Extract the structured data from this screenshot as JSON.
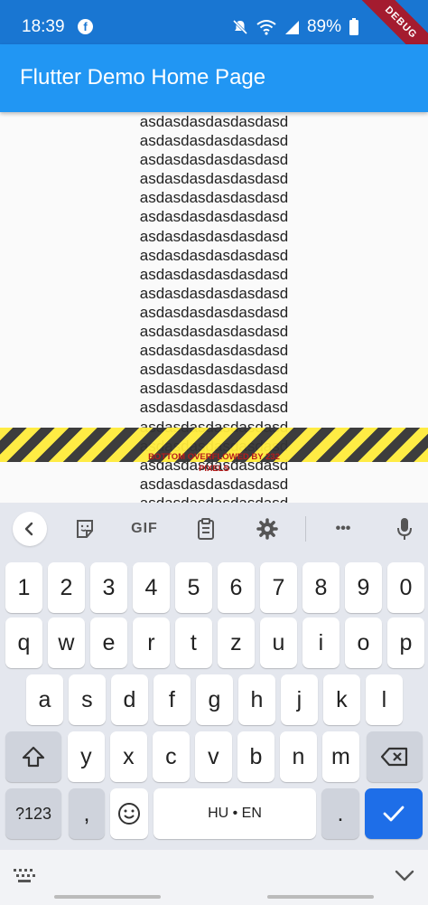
{
  "status_bar": {
    "time": "18:39",
    "battery": "89%",
    "icons": [
      "facebook-icon",
      "mute-icon",
      "wifi-icon",
      "signal-icon",
      "battery-icon"
    ]
  },
  "debug_banner": "DEBUG",
  "app_bar": {
    "title": "Flutter Demo Home Page"
  },
  "content": {
    "line_text": "asdasdasdasdasdasd",
    "lines": [
      "asdasdasdasdasdasd",
      "asdasdasdasdasdasd",
      "asdasdasdasdasdasd",
      "asdasdasdasdasdasd",
      "asdasdasdasdasdasd",
      "asdasdasdasdasdasd",
      "asdasdasdasdasdasd",
      "asdasdasdasdasdasd",
      "asdasdasdasdasdasd",
      "asdasdasdasdasdasd",
      "asdasdasdasdasdasd",
      "asdasdasdasdasdasd",
      "asdasdasdasdasdasd",
      "asdasdasdasdasdasd",
      "asdasdasdasdasdasd",
      "asdasdasdasdasdasd",
      "asdasdasdasdasdasd",
      "asdasdasdasdasdasd",
      "asdasdasdasdasdasd",
      "asdasdasdasdasdasd",
      "asdasdasdasdasdasd"
    ],
    "overflow_message": "BOTTOM OVERFLOWED BY 232 PIXELS"
  },
  "keyboard": {
    "toolbar": {
      "items": [
        "back-icon",
        "sticker-icon",
        "gif-button",
        "clipboard-icon",
        "settings-icon",
        "more-icon",
        "microphone-icon"
      ],
      "gif_label": "GIF",
      "more_label": "•••"
    },
    "rows": {
      "numbers": [
        "1",
        "2",
        "3",
        "4",
        "5",
        "6",
        "7",
        "8",
        "9",
        "0"
      ],
      "row1": [
        "q",
        "w",
        "e",
        "r",
        "t",
        "z",
        "u",
        "i",
        "o",
        "p"
      ],
      "row2": [
        "a",
        "s",
        "d",
        "f",
        "g",
        "h",
        "j",
        "k",
        "l"
      ],
      "row3": [
        "y",
        "x",
        "c",
        "v",
        "b",
        "n",
        "m"
      ]
    },
    "bottom_row": {
      "symbols": "?123",
      "comma": ",",
      "space": "HU • EN",
      "period": "."
    }
  },
  "nav_bar": {
    "icons": [
      "keyboard-icon",
      "chevron-down-icon"
    ]
  },
  "colors": {
    "status_bar": "#1976d2",
    "app_bar": "#2196f3",
    "keyboard_bg": "#e4e7ee",
    "enter_key": "#1e6ee8",
    "overflow_text": "#b71c1c"
  }
}
